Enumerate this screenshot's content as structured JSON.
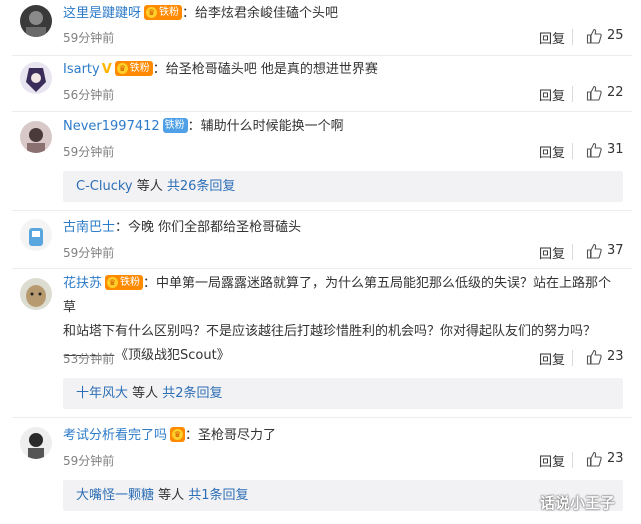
{
  "colors": {
    "username_orange": "#eb7350",
    "username_blue": "#2d7bc9",
    "link": "#2d6fb5",
    "time": "#808080",
    "sub_bg": "#f2f2f5",
    "badge_orange": "#ff8a00",
    "badge_blue": "#4fa0e6"
  },
  "comments": [
    {
      "username": "这里是踺踺呀",
      "badge": "铁粉",
      "text": "：给李炫君余峻佳磕个头吧",
      "time": "59分钟前",
      "reply": "回复",
      "likes": "25",
      "like_icon": "thumbs-up-icon"
    },
    {
      "username": "Isarty",
      "verified": "V",
      "badge": "铁粉",
      "text": "：给圣枪哥磕头吧 他是真的想进世界赛",
      "time": "56分钟前",
      "reply": "回复",
      "likes": "22",
      "like_icon": "thumbs-up-icon"
    },
    {
      "username": "Never1997412",
      "badge": "铁粉",
      "text": "：辅助什么时候能换一个啊",
      "time": "59分钟前",
      "reply": "回复",
      "likes": "31",
      "like_icon": "thumbs-up-icon",
      "sub": {
        "name": "C-Clucky",
        "mid": " 等人 ",
        "count": "共26条回复"
      }
    },
    {
      "username": "古南巴士",
      "text": "：今晚 你们全部都给圣枪哥磕头",
      "time": "59分钟前",
      "reply": "回复",
      "likes": "37",
      "like_icon": "thumbs-up-icon"
    },
    {
      "username": "花扶苏",
      "badge": "铁粉",
      "text_line1": "：中单第一局露露迷路就算了，为什么第五局能犯那么低级的失误？站在上路那个草",
      "text_line2": "和站塔下有什么区别吗？不是应该越往后打越珍惜胜利的机会吗？你对得起队友们的努力吗？",
      "text_line3": "————《顶级战犯Scout》",
      "time": "53分钟前",
      "reply": "回复",
      "likes": "23",
      "like_icon": "thumbs-up-icon",
      "sub": {
        "name": "十年风大",
        "mid": " 等人 ",
        "count": "共2条回复"
      }
    },
    {
      "username": "考试分析看完了吗",
      "badge": "",
      "text": "：圣枪哥尽力了",
      "time": "59分钟前",
      "reply": "回复",
      "likes": "23",
      "like_icon": "thumbs-up-icon",
      "sub": {
        "name": "大嘴怪一颗糖",
        "mid": " 等人 ",
        "count": "共1条回复"
      }
    }
  ],
  "watermark": "话说小王子"
}
